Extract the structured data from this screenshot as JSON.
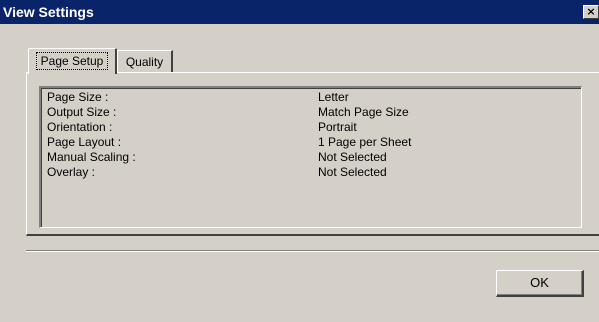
{
  "window": {
    "title": "View Settings",
    "close_glyph": "×"
  },
  "tabs": [
    {
      "label": "Page Setup",
      "active": true
    },
    {
      "label": "Quality",
      "active": false
    }
  ],
  "settings": [
    {
      "key": "Page Size :",
      "value": "Letter"
    },
    {
      "key": "Output Size :",
      "value": "Match Page Size"
    },
    {
      "key": "Orientation :",
      "value": "Portrait"
    },
    {
      "key": "Page Layout :",
      "value": "1 Page per Sheet"
    },
    {
      "key": "Manual Scaling :",
      "value": "Not Selected"
    },
    {
      "key": "Overlay :",
      "value": "Not Selected"
    }
  ],
  "buttons": {
    "ok_label": "OK"
  },
  "colors": {
    "titlebar": "#0a246a",
    "face": "#d4d0c8"
  },
  "icons": {
    "close": "close-icon"
  }
}
